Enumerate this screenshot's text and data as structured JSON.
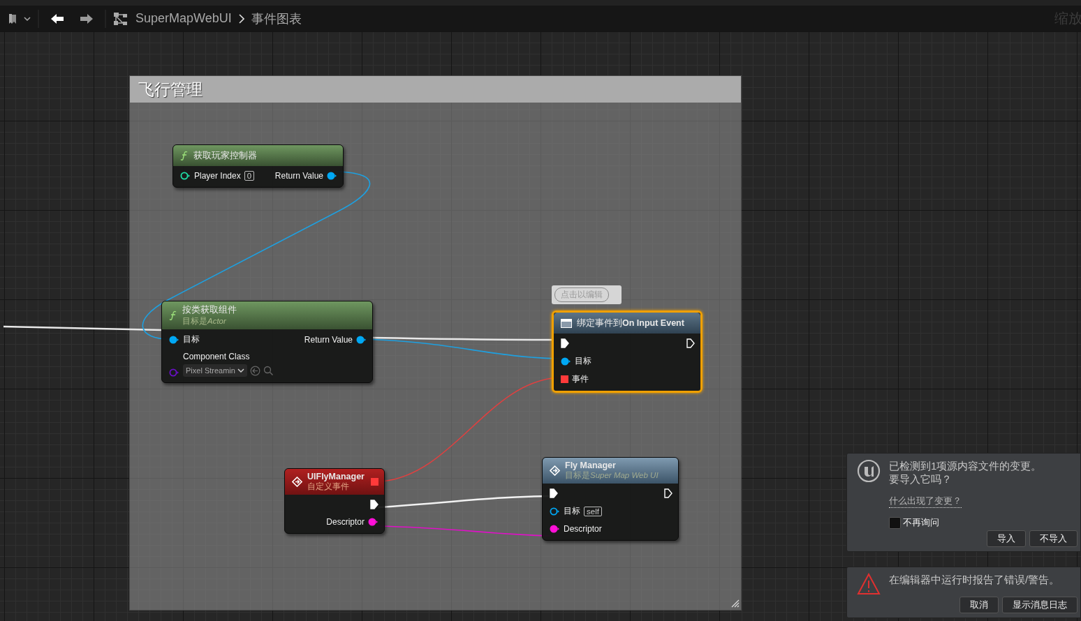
{
  "toolbar": {
    "breadcrumb": [
      "SuperMapWebUI",
      "事件图表"
    ],
    "zoom_label": "缩放"
  },
  "comment_box": {
    "title": "飞行管理"
  },
  "nodes": [
    {
      "kind": "function",
      "title": "获取玩家控制器",
      "selected": false,
      "rows": [
        {
          "left": {
            "kind": "int",
            "label": "Player Index",
            "connected": false,
            "value": "0"
          },
          "right": {
            "kind": "object",
            "label": "Return Value",
            "connected": true
          }
        }
      ]
    },
    {
      "kind": "function",
      "title": "按类获取组件",
      "subtitle": {
        "text": "目标是",
        "target": "Actor"
      },
      "selected": false,
      "rows": [
        {
          "left": {
            "kind": "object",
            "label": "目标",
            "connected": true
          },
          "right": {
            "kind": "object",
            "label": "Return Value",
            "connected": true
          }
        },
        {
          "left": {
            "kind": "class",
            "label": "Component Class",
            "connected": false,
            "dropdown": "Pixel Streamin"
          }
        }
      ]
    },
    {
      "kind": "bind",
      "title": "绑定事件到**On Input Event**",
      "comment_bubble": "点击以编辑",
      "selected": true,
      "rows": [
        {
          "left": {
            "kind": "exec",
            "connected": true
          },
          "right": {
            "kind": "exec",
            "connected": false
          }
        },
        {
          "left": {
            "kind": "object",
            "label": "目标",
            "connected": true
          }
        },
        {
          "left": {
            "kind": "delegate",
            "label": "事件",
            "connected": true
          }
        }
      ]
    },
    {
      "kind": "event",
      "title": "UIFlyManager",
      "subtitle": {
        "text": "自定义事件"
      },
      "selected": false,
      "header_pin": {
        "kind": "delegate",
        "connected": true
      },
      "rows": [
        {
          "right": {
            "kind": "exec",
            "connected": true
          }
        },
        {
          "right": {
            "kind": "struct",
            "label": "Descriptor",
            "connected": true
          }
        }
      ]
    },
    {
      "kind": "call",
      "title": "Fly Manager",
      "subtitle": {
        "text": "目标是",
        "target": "Super Map Web UI"
      },
      "selected": false,
      "rows": [
        {
          "left": {
            "kind": "exec",
            "connected": true
          },
          "right": {
            "kind": "exec",
            "connected": false
          }
        },
        {
          "left": {
            "kind": "object",
            "label": "目标",
            "connected": false,
            "value": "self"
          }
        },
        {
          "left": {
            "kind": "struct",
            "label": "Descriptor",
            "connected": true
          }
        }
      ]
    }
  ],
  "notifications": [
    {
      "kind": "import",
      "lines": [
        "已检测到1项源内容文件的变更。",
        "要导入它吗？"
      ],
      "link": "什么出现了变更？",
      "checkbox": {
        "label": "不再询问",
        "checked": false
      },
      "buttons": [
        "导入",
        "不导入"
      ]
    },
    {
      "kind": "warning",
      "lines": [
        "在编辑器中运行时报告了错误/警告。"
      ],
      "buttons": [
        "取消",
        "显示消息日志"
      ]
    }
  ]
}
